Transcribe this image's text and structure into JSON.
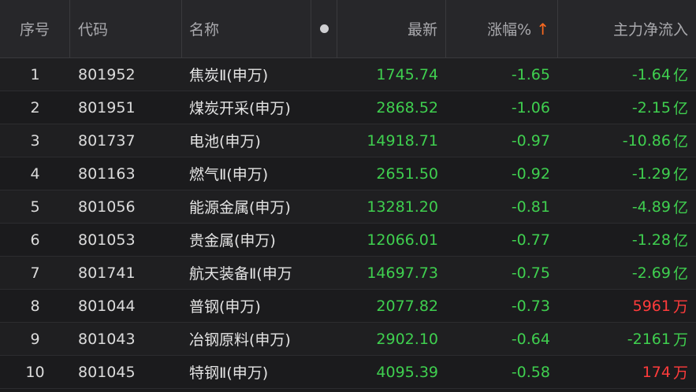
{
  "colors": {
    "down": "#3fcf4f",
    "up": "#ff3b3b",
    "sort_arrow": "#ff6a1f"
  },
  "header": {
    "no": "序号",
    "code": "代码",
    "name": "名称",
    "last": "最新",
    "change_pct": "涨幅%",
    "sort_arrow": "↑",
    "main_flow": "主力净流入"
  },
  "rows": [
    {
      "no": "1",
      "code": "801952",
      "name": "焦炭Ⅱ(申万)",
      "last": "1745.74",
      "chg": "-1.65",
      "flow": "-1.64",
      "unit": "亿",
      "dir": "neg"
    },
    {
      "no": "2",
      "code": "801951",
      "name": "煤炭开采(申万)",
      "last": "2868.52",
      "chg": "-1.06",
      "flow": "-2.15",
      "unit": "亿",
      "dir": "neg"
    },
    {
      "no": "3",
      "code": "801737",
      "name": "电池(申万)",
      "last": "14918.71",
      "chg": "-0.97",
      "flow": "-10.86",
      "unit": "亿",
      "dir": "neg"
    },
    {
      "no": "4",
      "code": "801163",
      "name": "燃气Ⅱ(申万)",
      "last": "2651.50",
      "chg": "-0.92",
      "flow": "-1.29",
      "unit": "亿",
      "dir": "neg"
    },
    {
      "no": "5",
      "code": "801056",
      "name": "能源金属(申万)",
      "last": "13281.20",
      "chg": "-0.81",
      "flow": "-4.89",
      "unit": "亿",
      "dir": "neg"
    },
    {
      "no": "6",
      "code": "801053",
      "name": "贵金属(申万)",
      "last": "12066.01",
      "chg": "-0.77",
      "flow": "-1.28",
      "unit": "亿",
      "dir": "neg"
    },
    {
      "no": "7",
      "code": "801741",
      "name": "航天装备Ⅱ(申万",
      "last": "14697.73",
      "chg": "-0.75",
      "flow": "-2.69",
      "unit": "亿",
      "dir": "neg"
    },
    {
      "no": "8",
      "code": "801044",
      "name": "普钢(申万)",
      "last": "2077.82",
      "chg": "-0.73",
      "flow": "5961",
      "unit": "万",
      "dir": "pos"
    },
    {
      "no": "9",
      "code": "801043",
      "name": "冶钢原料(申万)",
      "last": "2902.10",
      "chg": "-0.64",
      "flow": "-2161",
      "unit": "万",
      "dir": "neg"
    },
    {
      "no": "10",
      "code": "801045",
      "name": "特钢Ⅱ(申万)",
      "last": "4095.39",
      "chg": "-0.58",
      "flow": "174",
      "unit": "万",
      "dir": "pos"
    }
  ]
}
